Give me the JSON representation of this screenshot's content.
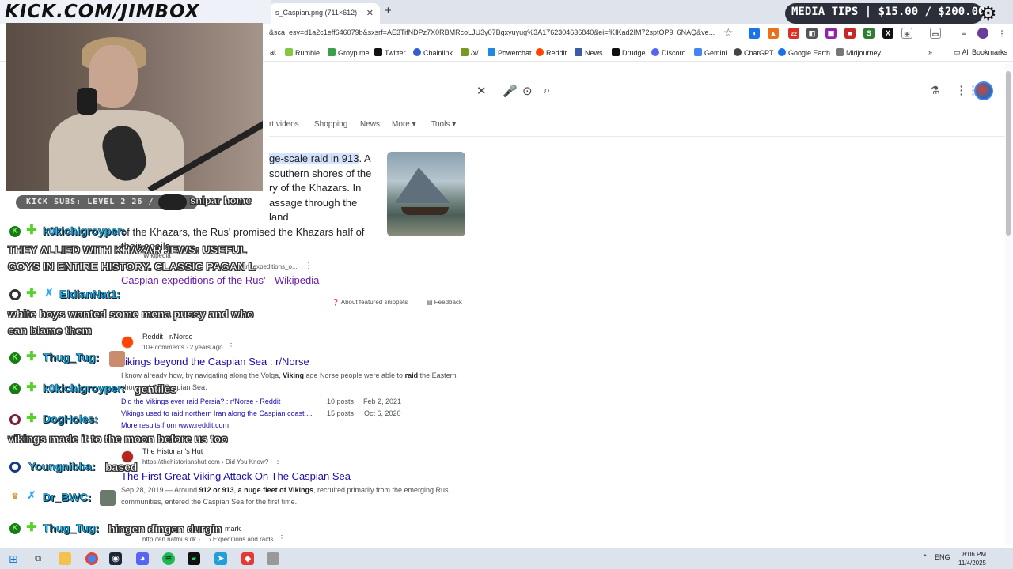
{
  "browser": {
    "tab_title": "s_Caspian.png (711×612)",
    "url": "&sca_esv=d1a2c1eff646079b&sxsrf=AE3TifNDPz7X0RBMRcoLJU3y07Bgxyuyug%3A1762304636840&ei=fKIKad2IM72sptQP9_6NAQ&ve...",
    "bookmarks": [
      "at",
      "Rumble",
      "Groyp.me",
      "Twitter",
      "Chainlink",
      "/x/",
      "Powerchat",
      "Reddit",
      "News",
      "Drudge",
      "Discord",
      "Gemini",
      "ChatGPT",
      "Google Earth",
      "Midjourney"
    ],
    "all_bookmarks": "All Bookmarks",
    "ext_badge": "22"
  },
  "google": {
    "nav": [
      "rt videos",
      "Shopping",
      "News",
      "More",
      "Tools"
    ],
    "snippet": {
      "hl": "ge-scale raid in 913",
      "line1_rest": ". A",
      "line2": "southern shores of the",
      "line3": "ry of the Khazars. In",
      "line4": "assage through the land",
      "line5": "of the Khazars, the Rus' promised the Khazars half of",
      "line6": "their spoils."
    },
    "wiki_source": "Wikipedia",
    "wiki_url": "spian_expeditions_o...",
    "wiki_title": "Caspian expeditions of the Rus' - Wikipedia",
    "about_snippets": "About featured snippets",
    "feedback": "Feedback",
    "r1": {
      "site": "Reddit · r/Norse",
      "meta": "10+ comments · 2 years ago",
      "title": "ikings beyond the Caspian Sea : r/Norse",
      "desc_a": "I know already how, by navigating along the Volga, ",
      "desc_b": "Viking",
      "desc_c": " age Norse people were able to ",
      "desc_d": "raid",
      "desc_e": " the Eastern",
      "desc2": "shores of the Caspian Sea.",
      "sub1": "Did the Vikings ever raid Persia? : r/Norse - Reddit",
      "sub1_posts": "10 posts",
      "sub1_date": "Feb 2, 2021",
      "sub2": "Vikings used to raid northern Iran along the Caspian coast ...",
      "sub2_posts": "15 posts",
      "sub2_date": "Oct 6, 2020",
      "more": "More results from www.reddit.com"
    },
    "r2": {
      "site": "The Historian's Hut",
      "url": "https://thehistorianshut.com › Did You Know?",
      "title": "The First Great Viking Attack On The Caspian Sea",
      "desc_a": "Sep 28, 2019 — Around ",
      "desc_b": "912 or 913",
      "desc_c": ", ",
      "desc_d": "a huge fleet of Vikings",
      "desc_e": ", recruited primarily from the emerging Rus",
      "desc2": "communities, entered the Caspian Sea for the first time."
    },
    "r3": {
      "site": "mark",
      "url": "http://en.natmus.dk › ... › Expeditions and raids"
    }
  },
  "overlay": {
    "banner": "KICK.COM/JIMBOX",
    "media": "MEDIA TIPS | $15.00 / $200.00",
    "kick_subs": "KICK SUBS: LEVEL 2 26 / 40",
    "sub_user": "snipar home"
  },
  "chat": [
    {
      "name": "k0kichigroyper:",
      "msg": ""
    },
    {
      "name": "",
      "msg": "THEY ALLIED WITH KHAZAR JEWS: USEFUL"
    },
    {
      "name": "",
      "msg": "GOYS IN ENTIRE HISTORY. CLASSIC PAGAN L"
    },
    {
      "name": "EldianNat1:",
      "msg": ""
    },
    {
      "name": "",
      "msg": "white boys wanted some mena pussy and who"
    },
    {
      "name": "",
      "msg": "can blame them"
    },
    {
      "name": "Thug_Tug:",
      "msg": ""
    },
    {
      "name": "k0kichigroyper:",
      "msg": "gentiles"
    },
    {
      "name": "DogHoles:",
      "msg": ""
    },
    {
      "name": "",
      "msg": "vikings made it to the moon before us too"
    },
    {
      "name": "Youngnibba:",
      "msg": "based"
    },
    {
      "name": "Dr_BWC:",
      "msg": ""
    },
    {
      "name": "Thug_Tug:",
      "msg": "hingen dingen durgin"
    }
  ],
  "taskbar": {
    "lang": "ENG",
    "time": "8:06 PM",
    "date": "11/4/2025"
  }
}
